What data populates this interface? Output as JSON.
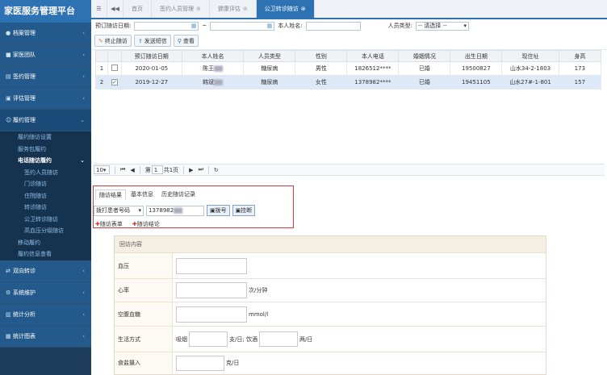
{
  "sidebar": {
    "title": "家医服务管理平台",
    "items": [
      {
        "label": "档案管理",
        "icon": "user-icon"
      },
      {
        "label": "家医团队",
        "icon": "team-icon"
      },
      {
        "label": "签约管理",
        "icon": "contract-icon"
      },
      {
        "label": "评估管理",
        "icon": "assess-icon"
      },
      {
        "label": "履约管理",
        "icon": "perform-icon"
      }
    ],
    "sub": [
      "履约随访设置",
      "服务包履约",
      "电话随访履约"
    ],
    "sub3": [
      "签约人员随访",
      "门诊随访",
      "住院随访",
      "转诊随访",
      "公卫转诊随访",
      "高血压分级随访"
    ],
    "sub_after": [
      "移动履约",
      "履约信息查看"
    ],
    "bottom": [
      {
        "label": "双向转诊",
        "icon": "transfer-icon"
      },
      {
        "label": "系统维护",
        "icon": "gear-icon"
      },
      {
        "label": "统计分析",
        "icon": "chart-icon"
      },
      {
        "label": "统计图表",
        "icon": "table-icon"
      }
    ]
  },
  "tabs": [
    "首页",
    "签约人员管理",
    "健康评估",
    "公卫转诊随访"
  ],
  "filter": {
    "date_label": "预订随访日期:",
    "date_sep": "~",
    "name_label": "本人姓名:",
    "type_label": "人员类型:",
    "type_value": "-- 请选择 --"
  },
  "toolbar": {
    "stop": "终止随访",
    "sms": "发送短信",
    "view": "查看"
  },
  "table": {
    "headers": [
      "预订随访日期",
      "本人姓名",
      "人员类型",
      "性别",
      "本人电话",
      "婚姻情况",
      "出生日期",
      "现住址",
      "身高"
    ],
    "rows": [
      {
        "num": "1",
        "checked": false,
        "date": "2020-01-05",
        "name": "陈王",
        "type": "糖尿病",
        "sex": "男性",
        "phone": "1826512****",
        "marital": "已婚",
        "birth": "19500827",
        "addr": "山水34-2-1803",
        "height": "173"
      },
      {
        "num": "2",
        "checked": true,
        "date": "2019-12-27",
        "name": "韩斌",
        "type": "糖尿病",
        "sex": "女性",
        "phone": "1378982****",
        "marital": "已婚",
        "birth": "19451105",
        "addr": "山水27#-1-801",
        "height": "157"
      }
    ]
  },
  "pager": {
    "size": "10",
    "page_prefix": "第",
    "page": "1",
    "page_suffix": "共1页"
  },
  "subtabs": [
    "随访结果",
    "基本信息",
    "历史随访记录"
  ],
  "dial": {
    "select": "拨打患者号码",
    "number": "1378982",
    "call": "拨号",
    "hangup": "挂断"
  },
  "add": {
    "form": "随访表单",
    "end": "随访结论"
  },
  "form": {
    "title": "回访内容",
    "bp": "血压",
    "hr": "心率",
    "hr_unit": "次/分钟",
    "glucose": "空腹血糖",
    "glucose_unit": "mmol/l",
    "life": "生活方式",
    "smoke": "吸烟",
    "smoke_unit": "支/日; 饮酒",
    "drink_unit": "两/日",
    "salt": "食盐摄入",
    "salt_unit": "克/日"
  }
}
